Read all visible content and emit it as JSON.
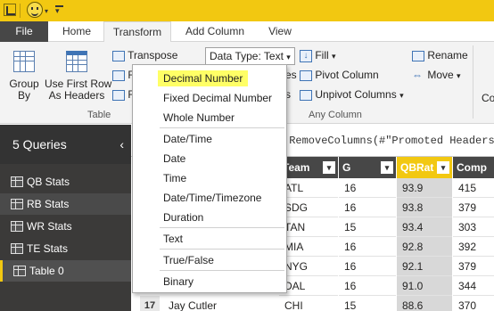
{
  "titlebar": {
    "icons": [
      "powerbi-logo",
      "smiley-feedback",
      "quick-access-dropdown"
    ]
  },
  "tabs": {
    "file": "File",
    "home": "Home",
    "transform": "Transform",
    "add_column": "Add Column",
    "view": "View"
  },
  "ribbon": {
    "table_group": {
      "group_by": "Group\nBy",
      "use_first_row": "Use First Row\nAs Headers",
      "label": "Table"
    },
    "transpose": "Transpose",
    "data_type": "Data Type: Text",
    "fill": "Fill",
    "pivot_column": "Pivot Column",
    "unpivot_columns": "Unpivot Columns",
    "rename": "Rename",
    "move": "Move",
    "any_column_label": "Any Column",
    "partial_left_1": "R",
    "partial_left_2": "F",
    "partial_left_3": "C",
    "partial_mid_1": "es",
    "partial_mid_2": "s",
    "partial_right": "Co"
  },
  "queries": {
    "header": "5 Queries",
    "collapse": "‹",
    "items": [
      {
        "label": "QB Stats"
      },
      {
        "label": "RB Stats"
      },
      {
        "label": "WR Stats"
      },
      {
        "label": "TE Stats"
      },
      {
        "label": "Table 0"
      }
    ]
  },
  "formula": ".RemoveColumns(#\"Promoted Headers\"",
  "grid": {
    "columns": [
      {
        "label": "Team"
      },
      {
        "label": "G"
      },
      {
        "label": "QBRat"
      },
      {
        "label": "Comp"
      }
    ],
    "rows": [
      {
        "team": "ATL",
        "g": "16",
        "qbrat": "93.9",
        "comp": "415"
      },
      {
        "team": "SDG",
        "g": "16",
        "qbrat": "93.8",
        "comp": "379"
      },
      {
        "team": "TAN",
        "g": "15",
        "qbrat": "93.4",
        "comp": "303"
      },
      {
        "team": "MIA",
        "g": "16",
        "qbrat": "92.8",
        "comp": "392"
      },
      {
        "team": "NYG",
        "g": "16",
        "qbrat": "92.1",
        "comp": "379"
      },
      {
        "team": "DAL",
        "g": "16",
        "qbrat": "91.0",
        "comp": "344"
      },
      {
        "team": "CHI",
        "g": "15",
        "qbrat": "88.6",
        "comp": "370"
      }
    ],
    "last_row_num": "17",
    "last_row_name": "Jay Cutler"
  },
  "menu": {
    "items": [
      {
        "label": "Decimal Number"
      },
      {
        "label": "Fixed Decimal Number"
      },
      {
        "label": "Whole Number"
      },
      {
        "label": "Date/Time"
      },
      {
        "label": "Date"
      },
      {
        "label": "Time"
      },
      {
        "label": "Date/Time/Timezone"
      },
      {
        "label": "Duration"
      },
      {
        "label": "Text"
      },
      {
        "label": "True/False"
      },
      {
        "label": "Binary"
      }
    ]
  },
  "colors": {
    "accent": "#f2c811",
    "pane": "#3b3a39",
    "highlight": "#ffff66"
  }
}
